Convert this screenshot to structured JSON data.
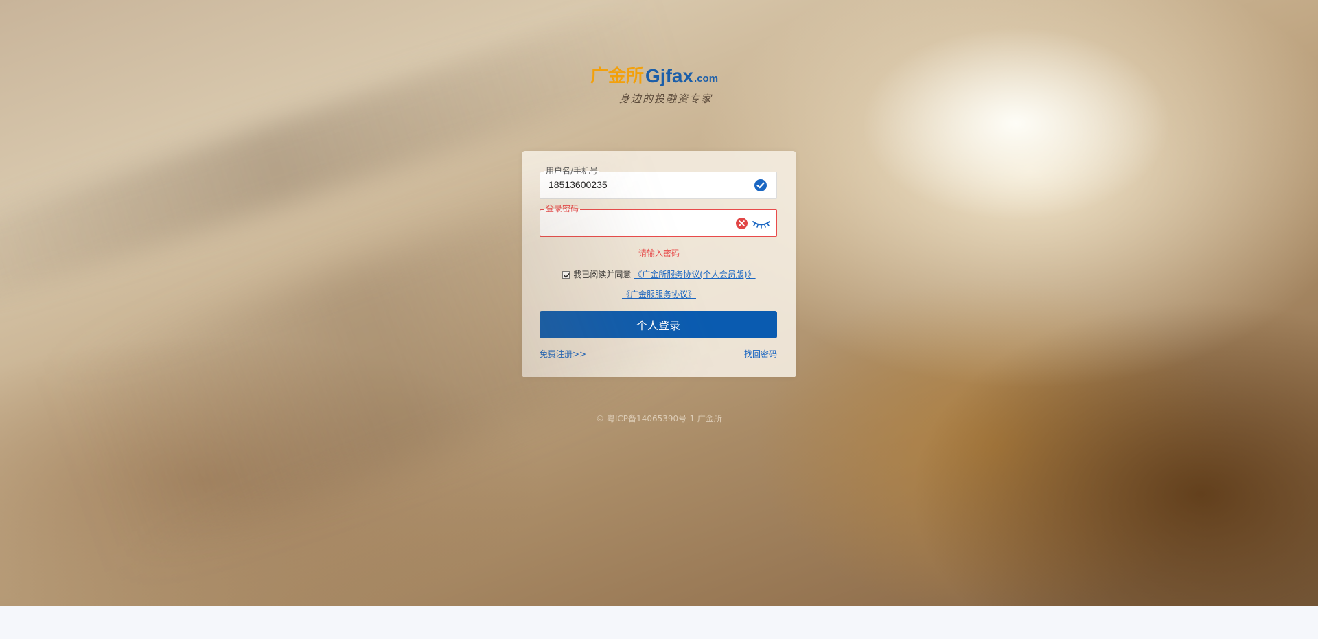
{
  "logo": {
    "cn": "广金所",
    "en": "Gjfax",
    "suffix": ".com"
  },
  "slogan": "身边的投融资专家",
  "form": {
    "username": {
      "label": "用户名/手机号",
      "value": "18513600235"
    },
    "password": {
      "label": "登录密码",
      "value": ""
    },
    "error_message": "请输入密码",
    "agreement": {
      "checked": true,
      "prefix": "我已阅读并同意",
      "link1": "《广金所服务协议(个人会员版)》",
      "link2": "《广金服服务协议》"
    },
    "login_button": "个人登录",
    "register_link": "免费注册>>",
    "forgot_link": "找回密码"
  },
  "footer": {
    "icp": "© 粤ICP备14065390号-1 广金所"
  },
  "icons": {
    "valid": "check-circle-icon",
    "clear": "clear-circle-icon",
    "toggle_password": "eye-closed-icon"
  },
  "colors": {
    "brand_orange": "#f2a00c",
    "brand_blue": "#1b5ea9",
    "button_blue": "#0a5bb0",
    "error_red": "#e84b4b",
    "link_blue": "#1a66c2"
  }
}
